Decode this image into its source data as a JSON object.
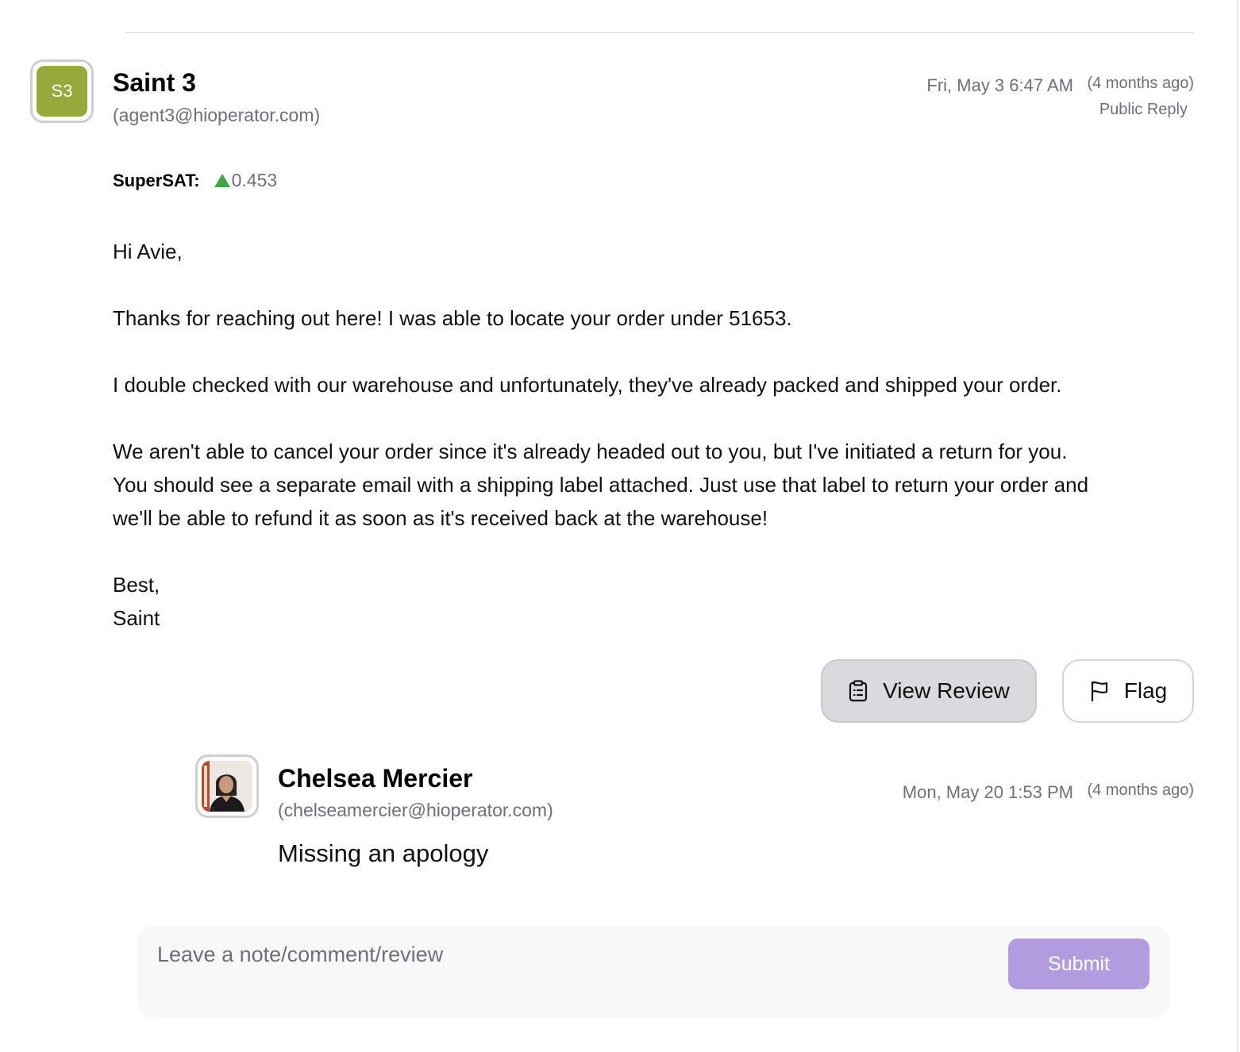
{
  "agent_message": {
    "avatar_initials": "S3",
    "avatar_color": "#99a83a",
    "name": "Saint 3",
    "email": "(agent3@hioperator.com)",
    "date": "Fri, May 3 6:47 AM",
    "relative_time": "(4 months ago)",
    "reply_type": "Public Reply",
    "supersat_label": "SuperSAT:",
    "supersat_value": "0.453",
    "supersat_trend": "up",
    "supersat_color": "#3fa64a",
    "body": {
      "greeting": "Hi Avie,",
      "paragraph_1": "Thanks for reaching out here! I was able to locate your order under 51653.",
      "paragraph_2": "I double checked with our warehouse and unfortunately, they've already packed and shipped your order.",
      "paragraph_3_line_1": "We aren't able to cancel your order since it's already headed out to you, but I've initiated a return for you.",
      "paragraph_3_line_2": "You should see a separate email with a shipping label attached. Just use that label to return your order and",
      "paragraph_3_line_3": "we'll be able to refund it as soon as it's received back at the warehouse!",
      "signoff": "Best,",
      "signature": "Saint"
    }
  },
  "actions": {
    "view_review_label": "View Review",
    "view_review_icon": "clipboard-list-icon",
    "flag_label": "Flag",
    "flag_icon": "flag-icon"
  },
  "review_comment": {
    "name": "Chelsea Mercier",
    "email": "(chelseamercier@hioperator.com)",
    "date": "Mon, May 20 1:53 PM",
    "relative_time": "(4 months ago)",
    "comment": "Missing an apology"
  },
  "comment_box": {
    "placeholder": "Leave a note/comment/review",
    "value": "",
    "submit_label": "Submit",
    "submit_color": "#b39be0"
  }
}
